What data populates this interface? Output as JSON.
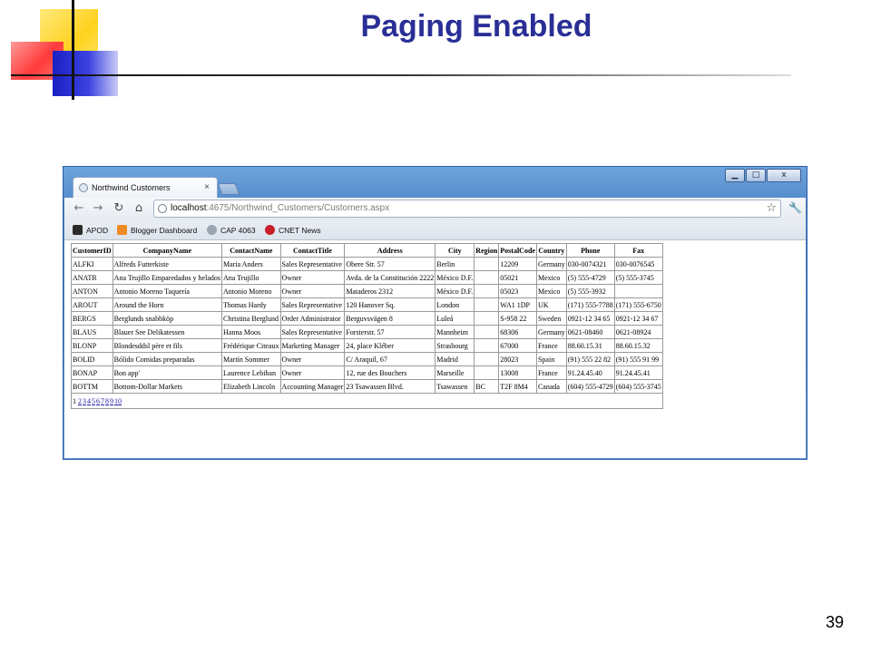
{
  "slide": {
    "title": "Paging Enabled",
    "page_number": "39"
  },
  "browser": {
    "tab_title": "Northwind Customers",
    "tab_close": "×",
    "url_host": "localhost",
    "url_rest": ":4675/Northwind_Customers/Customers.aspx",
    "window_controls": {
      "minimize": "▁",
      "maximize": "□",
      "close": "x"
    },
    "nav": {
      "back": "←",
      "forward": "→",
      "reload": "↻",
      "home": "⌂"
    },
    "star": "☆",
    "wrench": "🔧",
    "bookmarks": [
      {
        "label": "APOD",
        "color": "#2b2b2b"
      },
      {
        "label": "Blogger Dashboard",
        "color": "#f08a24"
      },
      {
        "label": "CAP 4063",
        "color": "#9aa7b3"
      },
      {
        "label": "CNET News",
        "color": "#c8202a"
      }
    ]
  },
  "grid": {
    "columns": [
      "CustomerID",
      "CompanyName",
      "ContactName",
      "ContactTitle",
      "Address",
      "City",
      "Region",
      "PostalCode",
      "Country",
      "Phone",
      "Fax"
    ],
    "rows": [
      [
        "ALFKI",
        "Alfreds Futterkiste",
        "Maria Anders",
        "Sales Representative",
        "Obere Str. 57",
        "Berlin",
        "",
        "12209",
        "Germany",
        "030-0074321",
        "030-0076545"
      ],
      [
        "ANATR",
        "Ana Trujillo Emparedados y helados",
        "Ana Trujillo",
        "Owner",
        "Avda. de la Constitución 2222",
        "México D.F.",
        "",
        "05021",
        "Mexico",
        "(5) 555-4729",
        "(5) 555-3745"
      ],
      [
        "ANTON",
        "Antonio Moreno Taquería",
        "Antonio Moreno",
        "Owner",
        "Mataderos 2312",
        "México D.F.",
        "",
        "05023",
        "Mexico",
        "(5) 555-3932",
        ""
      ],
      [
        "AROUT",
        "Around the Horn",
        "Thomas Hardy",
        "Sales Representative",
        "120 Hanover Sq.",
        "London",
        "",
        "WA1 1DP",
        "UK",
        "(171) 555-7788",
        "(171) 555-6750"
      ],
      [
        "BERGS",
        "Berglunds snabbköp",
        "Christina Berglund",
        "Order Administrator",
        "Berguvsvägen 8",
        "Luleå",
        "",
        "S-958 22",
        "Sweden",
        "0921-12 34 65",
        "0921-12 34 67"
      ],
      [
        "BLAUS",
        "Blauer See Delikatessen",
        "Hanna Moos",
        "Sales Representative",
        "Forsterstr. 57",
        "Mannheim",
        "",
        "68306",
        "Germany",
        "0621-08460",
        "0621-08924"
      ],
      [
        "BLONP",
        "Blondesddsl père et fils",
        "Frédérique Citeaux",
        "Marketing Manager",
        "24, place Kléber",
        "Strasbourg",
        "",
        "67000",
        "France",
        "88.60.15.31",
        "88.60.15.32"
      ],
      [
        "BOLID",
        "Bólido Comidas preparadas",
        "Martín Sommer",
        "Owner",
        "C/ Araquil, 67",
        "Madrid",
        "",
        "28023",
        "Spain",
        "(91) 555 22 82",
        "(91) 555 91 99"
      ],
      [
        "BONAP",
        "Bon app'",
        "Laurence Lebihan",
        "Owner",
        "12, rue des Bouchers",
        "Marseille",
        "",
        "13008",
        "France",
        "91.24.45.40",
        "91.24.45.41"
      ],
      [
        "BOTTM",
        "Bottom-Dollar Markets",
        "Elizabeth Lincoln",
        "Accounting Manager",
        "23 Tsawassen Blvd.",
        "Tsawassen",
        "BC",
        "T2F 8M4",
        "Canada",
        "(604) 555-4729",
        "(604) 555-3745"
      ]
    ],
    "pager": {
      "current": "1",
      "pages": [
        "2",
        "3",
        "4",
        "5",
        "6",
        "7",
        "8",
        "9",
        "10"
      ]
    }
  }
}
